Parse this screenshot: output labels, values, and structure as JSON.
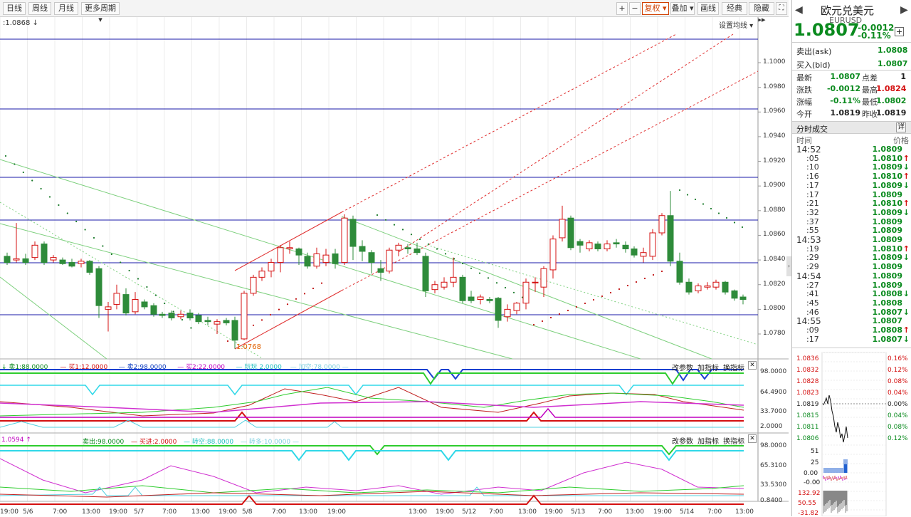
{
  "toolbar": {
    "tabs": [
      "日线",
      "周线",
      "月线",
      "更多周期 ▾"
    ],
    "right_buttons": [
      "+",
      "−",
      "复权 ▾",
      "叠加 ▾",
      "画线",
      "经典",
      "隐藏 ▸▸"
    ]
  },
  "chart": {
    "top_left_value": ":1.0868 ↓",
    "ma_setting": "设置均线 ▾",
    "price_ticks": [
      "1.1000",
      "1.0980",
      "1.0960",
      "1.0940",
      "1.0920",
      "1.0900",
      "1.0880",
      "1.0860",
      "1.0840",
      "1.0820",
      "1.0800",
      "1.0780"
    ],
    "low_annotation": "1.0768",
    "ind1": {
      "legend": [
        {
          "text": "↓ 卖1:88.0000",
          "color": "#0a8a1e"
        },
        {
          "text": "— 买1:12.0000",
          "color": "#d41010"
        },
        {
          "text": "— 卖2:98.0000",
          "color": "#1040c0"
        },
        {
          "text": "— 买2:22.0000",
          "color": "#c000c0"
        },
        {
          "text": "— 玩玩 2.0000",
          "color": "#20c0c0"
        },
        {
          "text": "— 加空:78.0000 —",
          "color": "#80d0e0"
        }
      ],
      "links": [
        "改参数",
        "加指标",
        "换指标"
      ],
      "ticks": [
        "98.0000",
        "64.4900",
        "33.7000",
        "2.0000"
      ]
    },
    "ind2": {
      "left_value": "1.0594 ↑",
      "legend": [
        {
          "text": "卖出:98.0000",
          "color": "#0a8a1e"
        },
        {
          "text": "— 买进:2.0000",
          "color": "#d41010"
        },
        {
          "text": "— 转空:88.0000",
          "color": "#20c0c0"
        },
        {
          "text": "— 转多:10.0000 —",
          "color": "#80d0e0"
        }
      ],
      "links": [
        "改参数",
        "加指标",
        "换指标"
      ],
      "ticks": [
        "98.0000",
        "65.3100",
        "33.5300",
        "0.8400"
      ]
    },
    "x_ticks": [
      "19:00",
      "5/6",
      "7:00",
      "13:00",
      "19:00",
      "5/7",
      "7:00",
      "13:00",
      "19:00",
      "5/8",
      "7:00",
      "13:00",
      "19:00",
      "13:00",
      "19:00",
      "5/12",
      "7:00",
      "13:00",
      "19:00",
      "5/13",
      "7:00",
      "13:00",
      "19:00",
      "5/14",
      "7:00",
      "13:00"
    ]
  },
  "panel": {
    "name_cn": "欧元兑美元",
    "code": "EURUSD",
    "price": "1.0807",
    "change": "-0.0012",
    "change_pct": "-0.11%",
    "ask_label": "卖出(ask)",
    "ask": "1.0808",
    "bid_label": "买入(bid)",
    "bid": "1.0807",
    "stats": [
      {
        "l1": "最新",
        "v1": "1.0807",
        "c1": "green",
        "l2": "点差",
        "v2": "1",
        "c2": "black"
      },
      {
        "l1": "涨跌",
        "v1": "-0.0012",
        "c1": "green",
        "l2": "最高",
        "v2": "1.0824",
        "c2": "red"
      },
      {
        "l1": "涨幅",
        "v1": "-0.11%",
        "c1": "green",
        "l2": "最低",
        "v2": "1.0802",
        "c2": "green"
      },
      {
        "l1": "今开",
        "v1": "1.0819",
        "c1": "black",
        "l2": "昨收",
        "v2": "1.0819",
        "c2": "black"
      }
    ],
    "trades_title": "分时成交",
    "trades_detail": "详",
    "trades_col_time": "时间",
    "trades_col_price": "价格",
    "trades": [
      {
        "t": "14:52",
        "p": "1.0809",
        "a": ""
      },
      {
        "t": ":05",
        "p": "1.0810",
        "a": "↑"
      },
      {
        "t": ":10",
        "p": "1.0809",
        "a": "↓"
      },
      {
        "t": ":16",
        "p": "1.0810",
        "a": "↑"
      },
      {
        "t": ":17",
        "p": "1.0809",
        "a": "↓"
      },
      {
        "t": ":17",
        "p": "1.0809",
        "a": ""
      },
      {
        "t": ":21",
        "p": "1.0810",
        "a": "↑"
      },
      {
        "t": ":32",
        "p": "1.0809",
        "a": "↓"
      },
      {
        "t": ":37",
        "p": "1.0809",
        "a": ""
      },
      {
        "t": ":55",
        "p": "1.0809",
        "a": ""
      },
      {
        "t": "14:53",
        "p": "1.0809",
        "a": ""
      },
      {
        "t": ":19",
        "p": "1.0810",
        "a": "↑"
      },
      {
        "t": ":29",
        "p": "1.0809",
        "a": "↓"
      },
      {
        "t": ":29",
        "p": "1.0809",
        "a": ""
      },
      {
        "t": "14:54",
        "p": "1.0809",
        "a": ""
      },
      {
        "t": ":27",
        "p": "1.0809",
        "a": ""
      },
      {
        "t": ":41",
        "p": "1.0808",
        "a": "↓"
      },
      {
        "t": ":45",
        "p": "1.0808",
        "a": ""
      },
      {
        "t": ":46",
        "p": "1.0807",
        "a": "↓"
      },
      {
        "t": "14:55",
        "p": "1.0807",
        "a": ""
      },
      {
        "t": ":09",
        "p": "1.0808",
        "a": "↑"
      },
      {
        "t": ":17",
        "p": "1.0807",
        "a": "↓"
      }
    ],
    "mini_left": [
      "1.0836",
      "1.0832",
      "1.0828",
      "1.0823",
      "1.0819",
      "1.0815",
      "1.0811",
      "1.0806"
    ],
    "mini_right": [
      "0.16%",
      "0.12%",
      "0.08%",
      "0.04%",
      "0.00%",
      "0.04%",
      "0.08%",
      "0.12%"
    ],
    "mini_vol": [
      "51",
      "25",
      "0.00"
    ],
    "mini_ind": [
      "-0.00",
      "132.92",
      "50.55",
      "-31.82"
    ]
  },
  "colors": {
    "up": "#d41010",
    "down": "#2e8b3a",
    "blue_line": "#1a1aa8"
  }
}
